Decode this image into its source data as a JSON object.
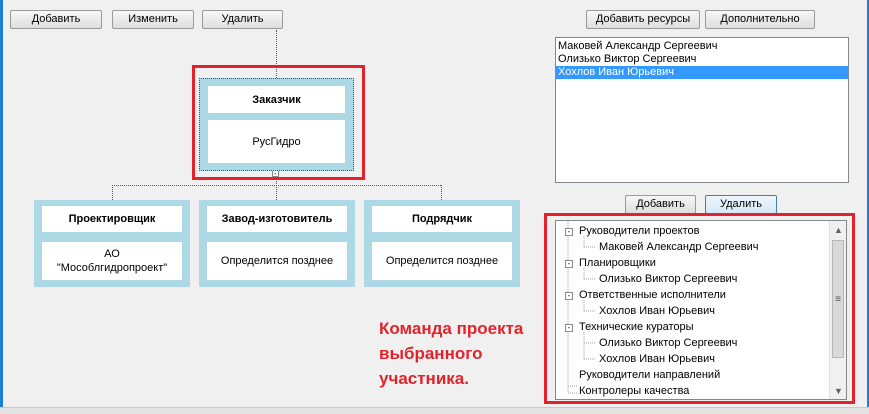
{
  "toolbar": {
    "add_label": "Добавить",
    "edit_label": "Изменить",
    "delete_label": "Удалить",
    "add_resources_label": "Добавить ресурсы",
    "more_label": "Дополнительно"
  },
  "org_chart": {
    "root": {
      "title": "Заказчик",
      "value": "РусГидро"
    },
    "children": [
      {
        "title": "Проектировщик",
        "value": "АО\n\"Мособлгидропроект\""
      },
      {
        "title": "Завод-изготовитель",
        "value": "Определится позднее"
      },
      {
        "title": "Подрядчик",
        "value": "Определится позднее"
      }
    ]
  },
  "resources": {
    "items": [
      {
        "label": "Маковей Александр Сергеевич",
        "selected": false
      },
      {
        "label": "Олизько Виктор Сергеевич",
        "selected": false
      },
      {
        "label": "Хохлов Иван Юрьевич",
        "selected": true
      }
    ]
  },
  "team_actions": {
    "add_label": "Добавить",
    "delete_label": "Удалить"
  },
  "team_tree": {
    "groups": [
      {
        "label": "Руководители проектов",
        "expanded": true,
        "members": [
          "Маковей Александр Сергеевич"
        ]
      },
      {
        "label": "Планировщики",
        "expanded": true,
        "members": [
          "Олизько Виктор Сергеевич"
        ]
      },
      {
        "label": "Ответственные исполнители",
        "expanded": true,
        "members": [
          "Хохлов Иван Юрьевич"
        ]
      },
      {
        "label": "Технические кураторы",
        "expanded": true,
        "members": [
          "Олизько Виктор Сергеевич",
          "Хохлов Иван Юрьевич"
        ]
      },
      {
        "label": "Руководители направлений",
        "expanded": false,
        "members": []
      },
      {
        "label": "Контролеры качества",
        "expanded": false,
        "members": []
      }
    ]
  },
  "annotation": {
    "line1": "Команда проекта",
    "line2": "выбранного",
    "line3": "участника."
  },
  "colors": {
    "node_fill": "#add8e6",
    "highlight": "#e3232b",
    "selection": "#3399ff"
  }
}
